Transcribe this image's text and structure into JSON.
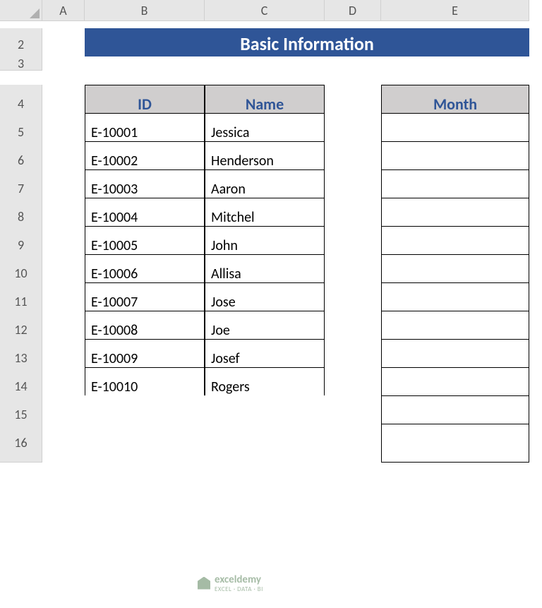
{
  "columns": [
    "A",
    "B",
    "C",
    "D",
    "E"
  ],
  "row_numbers": [
    "2",
    "3",
    "4",
    "5",
    "6",
    "7",
    "8",
    "9",
    "10",
    "11",
    "12",
    "13",
    "14",
    "15",
    "16"
  ],
  "title": "Basic Information",
  "headers": {
    "id": "ID",
    "name": "Name",
    "month": "Month"
  },
  "rows": [
    {
      "id": "E-10001",
      "name": "Jessica"
    },
    {
      "id": "E-10002",
      "name": "Henderson"
    },
    {
      "id": "E-10003",
      "name": "Aaron"
    },
    {
      "id": "E-10004",
      "name": "Mitchel"
    },
    {
      "id": "E-10005",
      "name": "John"
    },
    {
      "id": "E-10006",
      "name": "Allisa"
    },
    {
      "id": "E-10007",
      "name": "Jose"
    },
    {
      "id": "E-10008",
      "name": "Joe"
    },
    {
      "id": "E-10009",
      "name": "Josef"
    },
    {
      "id": "E-10010",
      "name": "Rogers"
    }
  ],
  "month_values": [
    "",
    "",
    "",
    "",
    "",
    "",
    "",
    "",
    "",
    "",
    "",
    ""
  ],
  "watermark": {
    "name": "exceldemy",
    "tag": "EXCEL · DATA · BI"
  }
}
